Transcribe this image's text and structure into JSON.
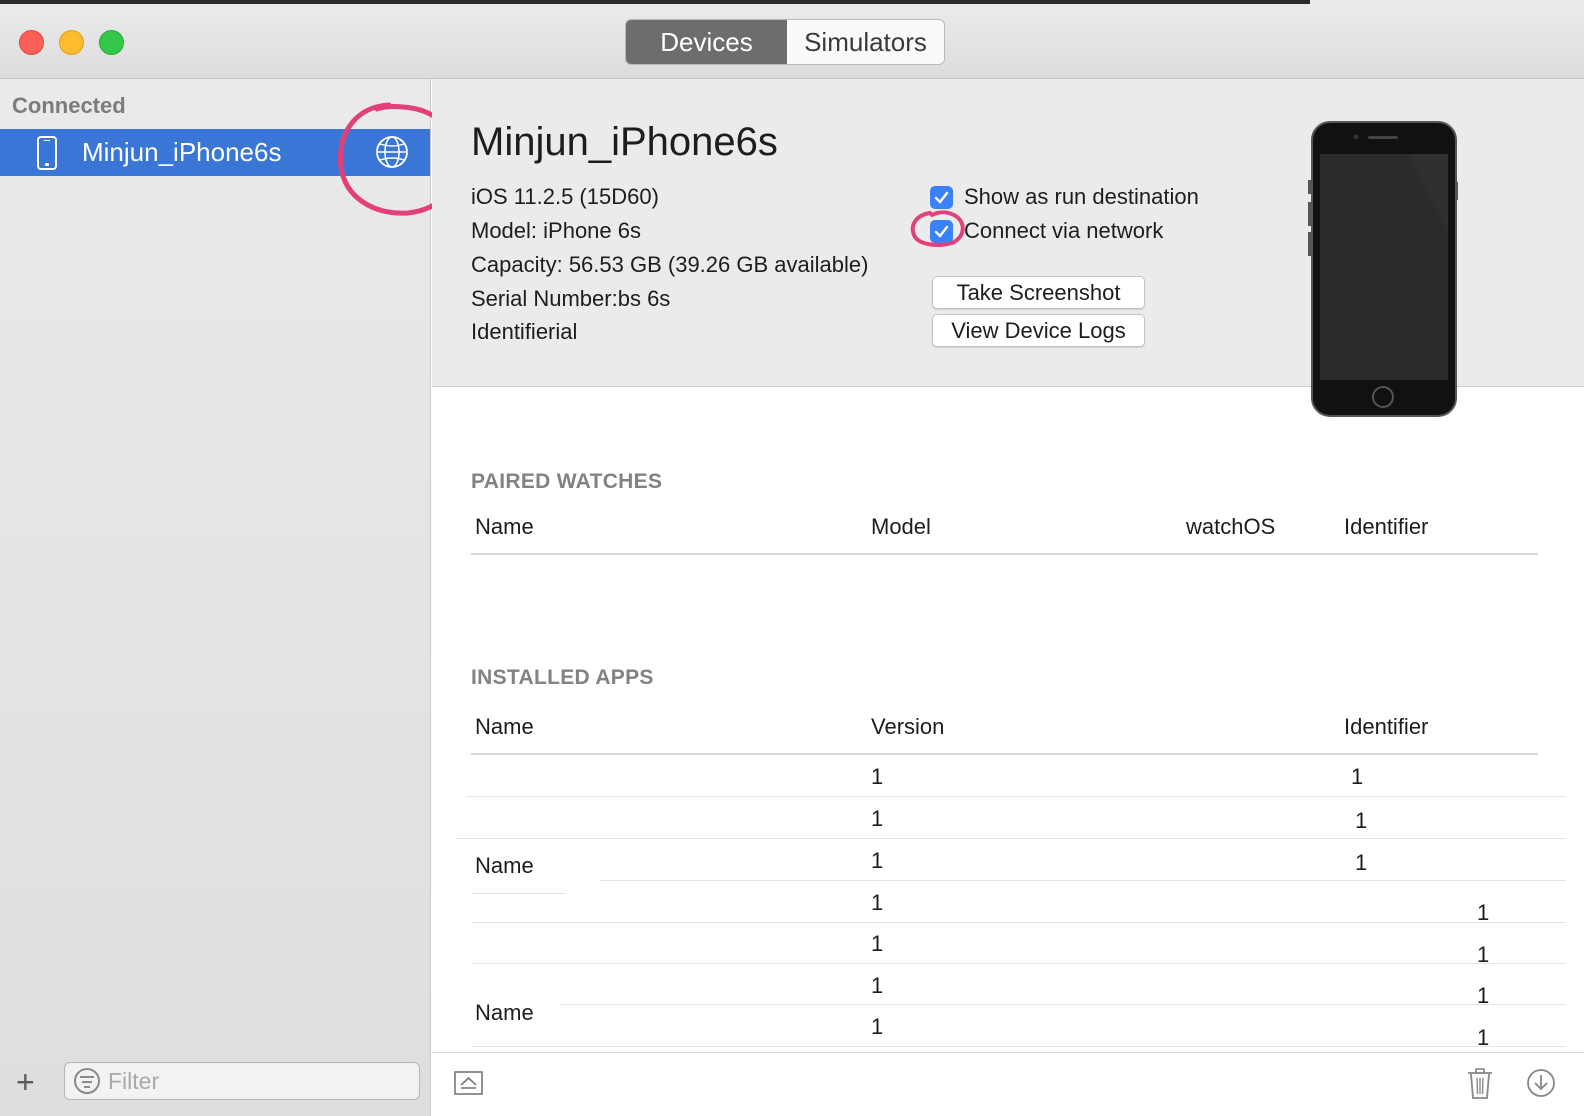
{
  "toolbar": {
    "tabs": [
      "Devices",
      "Simulators"
    ],
    "active_tab": "Devices"
  },
  "sidebar": {
    "section_header": "Connected",
    "devices": [
      {
        "name": "Minjun_iPhone6s",
        "icon": "iphone-icon",
        "status_icon": "network-globe-icon",
        "selected": true
      }
    ],
    "add_icon": "plus-icon",
    "filter": {
      "placeholder": "Filter",
      "value": ""
    }
  },
  "device": {
    "name": "Minjun_iPhone6s",
    "ios": "iOS 11.2.5 (15D60)",
    "model": "Model: iPhone 6s",
    "capacity": "Capacity: 56.53 GB (39.26 GB available)",
    "serial": "Serial Number:bs 6s",
    "identifier": "Identifierial",
    "options": [
      {
        "label": "Show as run destination",
        "checked": true
      },
      {
        "label": "Connect via network",
        "checked": true
      }
    ],
    "buttons": {
      "screenshot": "Take Screenshot",
      "logs": "View Device Logs"
    }
  },
  "paired_watches": {
    "title": "PAIRED WATCHES",
    "columns": [
      "Name",
      "Model",
      "watchOS",
      "Identifier"
    ],
    "rows": []
  },
  "installed_apps": {
    "title": "INSTALLED APPS",
    "columns": [
      "Name",
      "Version",
      "Identifier"
    ],
    "name_cells": [
      "Name",
      "Name"
    ],
    "versions": [
      "1",
      "1",
      "1",
      "1",
      "1",
      "1",
      "1"
    ],
    "identifiers": [
      "1",
      "1",
      "1",
      "1",
      "1",
      "1",
      "1"
    ]
  },
  "bottom_icons": [
    "eject-icon",
    "trash-icon",
    "download-icon"
  ],
  "colors": {
    "accent": "#3a76d6",
    "checkbox": "#3a82f7",
    "annotation": "#e2407b"
  }
}
